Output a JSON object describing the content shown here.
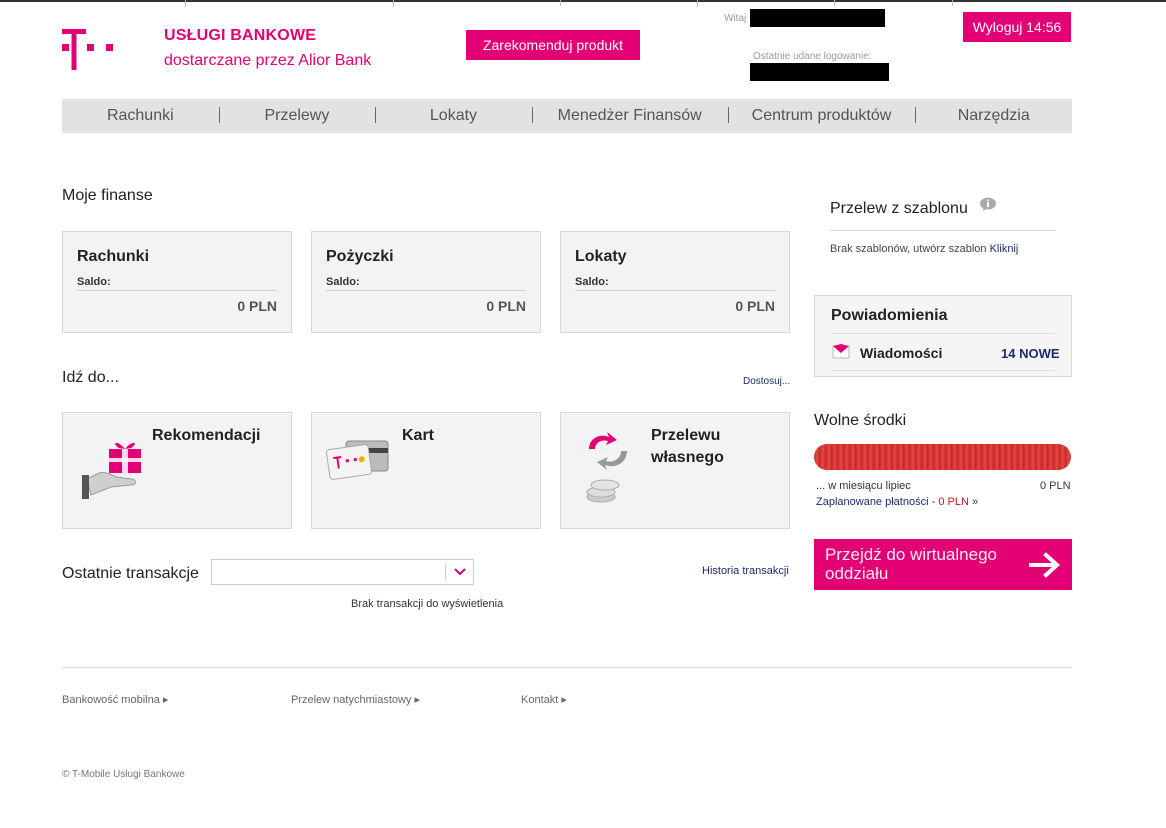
{
  "header": {
    "brand_title": "USŁUGI BANKOWE",
    "brand_subtitle": "dostarczane przez Alior Bank",
    "recommend_label": "Zarekomenduj produkt",
    "welcome_label": "Witaj",
    "last_login_label": "Ostatnie udane logowanie:",
    "logout_label": "Wyloguj 14:56"
  },
  "nav": {
    "items": [
      "Rachunki",
      "Przelewy",
      "Lokaty",
      "Menedżer Finansów",
      "Centrum produktów",
      "Narzędzia"
    ]
  },
  "finances": {
    "heading": "Moje finanse",
    "boxes": [
      {
        "title": "Rachunki",
        "saldo_label": "Saldo:",
        "value": "0 PLN"
      },
      {
        "title": "Pożyczki",
        "saldo_label": "Saldo:",
        "value": "0 PLN"
      },
      {
        "title": "Lokaty",
        "saldo_label": "Saldo:",
        "value": "0 PLN"
      }
    ]
  },
  "goto": {
    "heading": "Idź do...",
    "customize_label": "Dostosuj...",
    "tiles": [
      {
        "line1": "Rekomendacji",
        "line2": ""
      },
      {
        "line1": "Kart",
        "line2": ""
      },
      {
        "line1": "Przelewu",
        "line2": "własnego"
      }
    ]
  },
  "transactions": {
    "heading": "Ostatnie transakcje",
    "history_label": "Historia transakcji",
    "empty_label": "Brak transakcji do wyświetlenia"
  },
  "sidebar": {
    "template_title": "Przelew z szablonu",
    "template_empty": "Brak szablonów, utwórz szablon",
    "template_link": "Kliknij",
    "notifications_title": "Powiadomienia",
    "messages_label": "Wiadomości",
    "messages_count": "14 NOWE",
    "free_funds_title": "Wolne środki",
    "month_label": "... w miesiącu lipiec",
    "month_value": "0 PLN",
    "planned_label": "Zaplanowane płatności",
    "planned_sep": " - ",
    "planned_value": "0 PLN",
    "planned_arrow": " »",
    "cta_line1": "Przejdź do wirtualnego",
    "cta_line2": "oddziału"
  },
  "footer": {
    "links": [
      "Bankowość mobilna ▸",
      "Przelew natychmiastowy ▸",
      "Kontakt ▸"
    ],
    "copyright": "© T-Mobile Usługi Bankowe"
  },
  "colors": {
    "brand": "#e20074",
    "nav_bg": "#e2e2e2",
    "bar_red": "#d42a2a",
    "link": "#1c2b6b"
  },
  "icons": [
    "telekom-logo-icon",
    "info-icon",
    "envelope-icon",
    "gift-hand-icon",
    "cards-icon",
    "transfer-arrows-icon",
    "coins-icon",
    "chevron-down-icon",
    "arrow-right-icon"
  ]
}
